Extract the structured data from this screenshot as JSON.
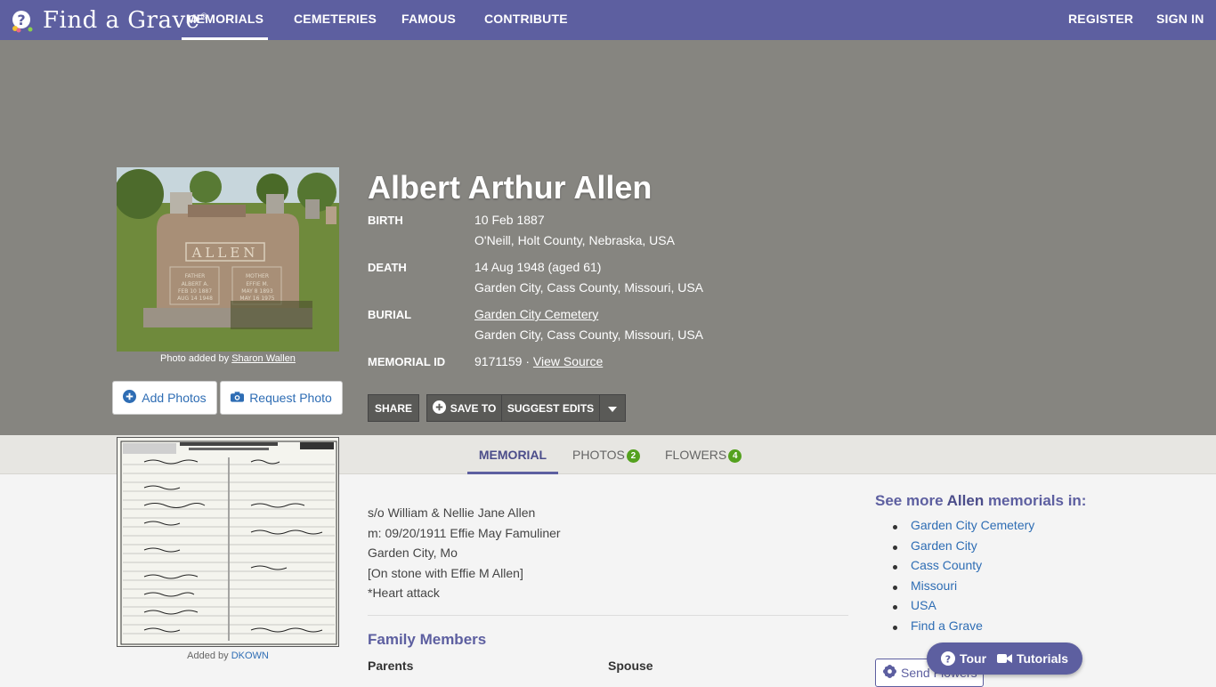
{
  "nav": {
    "logo_text": "Find a Grave",
    "logo_reg": "®",
    "links": [
      "MEMORIALS",
      "CEMETERIES",
      "FAMOUS",
      "CONTRIBUTE"
    ],
    "register": "REGISTER",
    "sign_in": "SIGN IN"
  },
  "memorial": {
    "name": "Albert Arthur Allen",
    "photo_caption_prefix": "Photo added by",
    "photo_added_by": "Sharon Wallen",
    "add_photos": "Add Photos",
    "request_photo": "Request Photo",
    "birth_label": "BIRTH",
    "birth_date": "10 Feb 1887",
    "birth_place": "O'Neill, Holt County, Nebraska, USA",
    "death_label": "DEATH",
    "death_date": "14 Aug 1948 (aged 61)",
    "death_place": "Garden City, Cass County, Missouri, USA",
    "burial_label": "BURIAL",
    "burial_cemetery": "Garden City Cemetery",
    "burial_place": "Garden City, Cass County, Missouri, USA",
    "id_label": "MEMORIAL ID",
    "memorial_id": "9171159 ·",
    "view_source": "View Source",
    "headstone_name": "ALLEN",
    "headstone_left": "FATHER\nALBERT A.\nFEB 10 1887\nAUG 14 1948",
    "headstone_right": "MOTHER\nEFFIE M.\nMAY 8 1893\nMAY 16 1975"
  },
  "actions": {
    "share": "SHARE",
    "save_to": "SAVE TO",
    "suggest_edits": "SUGGEST EDITS"
  },
  "tabs": {
    "memorial": "MEMORIAL",
    "photos": "PHOTOS",
    "photos_count": "2",
    "flowers": "FLOWERS",
    "flowers_count": "4"
  },
  "certificate": {
    "caption_prefix": "Added by",
    "added_by": "DKOWN"
  },
  "bio": {
    "lines": [
      "s/o William & Nellie Jane Allen",
      "m: 09/20/1911 Effie May Famuliner",
      "Garden City, Mo",
      "[On stone with Effie M Allen]",
      "*Heart attack"
    ]
  },
  "family": {
    "heading": "Family Members",
    "parents": "Parents",
    "spouse": "Spouse"
  },
  "see_more": {
    "prefix": "See more",
    "surname": "Allen",
    "suffix": "memorials in:",
    "items": [
      "Garden City Cemetery",
      "Garden City",
      "Cass County",
      "Missouri",
      "USA",
      "Find a Grave"
    ]
  },
  "send_flowers": "Send Flowers",
  "help": {
    "tour": "Tour",
    "tutorials": "Tutorials"
  },
  "colors": {
    "brand": "#5d5fa0",
    "hero_bg": "#868580",
    "link": "#2e6db4",
    "badge": "#54a11e"
  }
}
